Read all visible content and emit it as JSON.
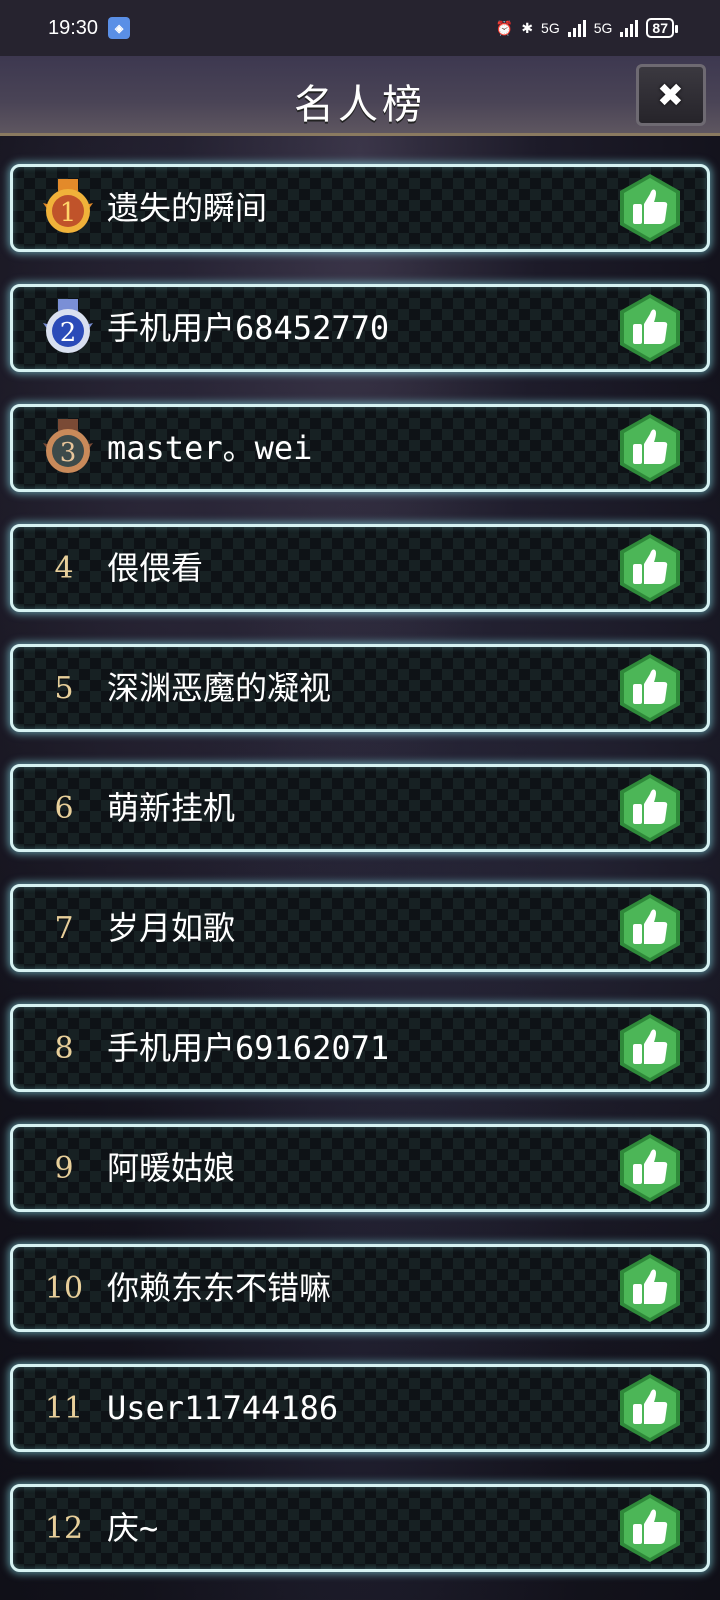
{
  "status_bar": {
    "time": "19:30",
    "network_1": "5G",
    "network_2": "5G",
    "battery": "87"
  },
  "header": {
    "title": "名人榜"
  },
  "icons": {
    "close": "close-icon",
    "like": "thumbs-up-icon",
    "gold_medal": "gold-medal-icon",
    "silver_medal": "silver-medal-icon",
    "bronze_medal": "bronze-medal-icon"
  },
  "colors": {
    "row_border": "#d6f2f2",
    "like_green": "#3fa64a",
    "rank_number": "#e8cf9a"
  },
  "rankings": [
    {
      "rank": "1",
      "name": "遗失的瞬间",
      "medal": "gold"
    },
    {
      "rank": "2",
      "name": "手机用户68452770",
      "medal": "silver"
    },
    {
      "rank": "3",
      "name": "master。wei",
      "medal": "bronze"
    },
    {
      "rank": "4",
      "name": "偎偎看"
    },
    {
      "rank": "5",
      "name": "深渊恶魔的凝视"
    },
    {
      "rank": "6",
      "name": "萌新挂机"
    },
    {
      "rank": "7",
      "name": "岁月如歌"
    },
    {
      "rank": "8",
      "name": "手机用户69162071"
    },
    {
      "rank": "9",
      "name": "阿暖姑娘"
    },
    {
      "rank": "10",
      "name": "你赖东东不错嘛"
    },
    {
      "rank": "11",
      "name": "User11744186"
    },
    {
      "rank": "12",
      "name": "庆~"
    }
  ]
}
